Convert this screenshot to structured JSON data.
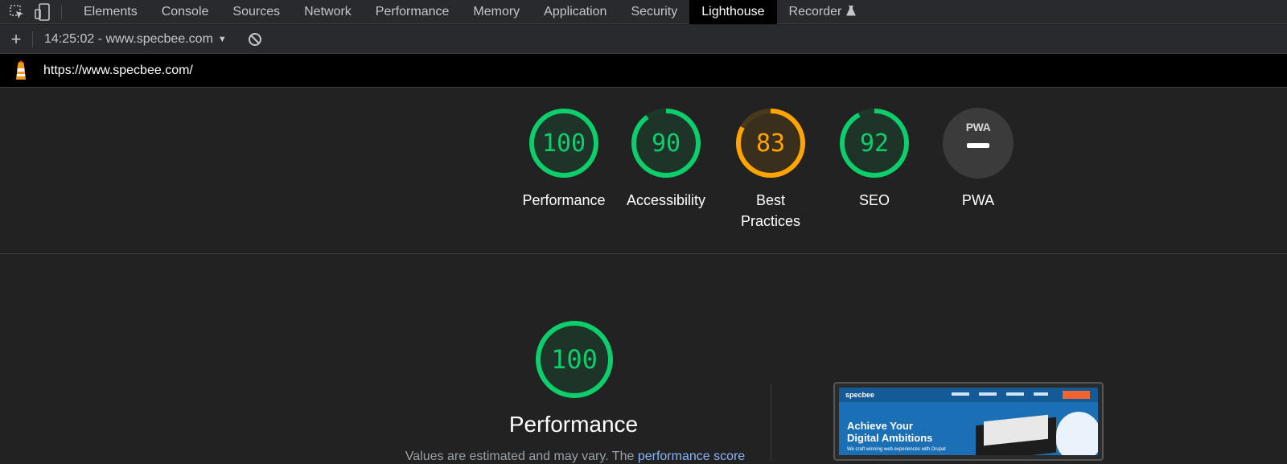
{
  "devtools": {
    "tabs": [
      {
        "label": "Elements"
      },
      {
        "label": "Console"
      },
      {
        "label": "Sources"
      },
      {
        "label": "Network"
      },
      {
        "label": "Performance"
      },
      {
        "label": "Memory"
      },
      {
        "label": "Application"
      },
      {
        "label": "Security"
      },
      {
        "label": "Lighthouse",
        "active": true
      },
      {
        "label": "Recorder"
      }
    ],
    "icons": [
      "inspect-icon",
      "device-toolbar-icon",
      "flask-icon"
    ]
  },
  "toolbar": {
    "report_selector": "14:25:02 - www.specbee.com",
    "icons": [
      "plus-icon",
      "chevron-down-icon",
      "clear-icon"
    ]
  },
  "urlbar": {
    "url": "https://www.specbee.com/"
  },
  "summary": {
    "gauges": [
      {
        "label": "Performance",
        "score": "100",
        "value": 100,
        "color": "#0cce6b"
      },
      {
        "label": "Accessibility",
        "score": "90",
        "value": 90,
        "color": "#0cce6b"
      },
      {
        "label_line1": "Best",
        "label_line2": "Practices",
        "score": "83",
        "value": 83,
        "color": "#ffa400"
      },
      {
        "label": "SEO",
        "score": "92",
        "value": 92,
        "color": "#0cce6b"
      },
      {
        "label": "PWA",
        "badge_text": "PWA"
      }
    ]
  },
  "performance": {
    "score": "100",
    "value": 100,
    "title": "Performance",
    "note_prefix": "Values are estimated and may vary. The ",
    "note_link": "performance score"
  },
  "screenshot": {
    "logo": "specbee",
    "headline_line1": "Achieve Your",
    "headline_line2": "Digital Ambitions",
    "subline": "We craft winning web experiences with Drupal"
  }
}
